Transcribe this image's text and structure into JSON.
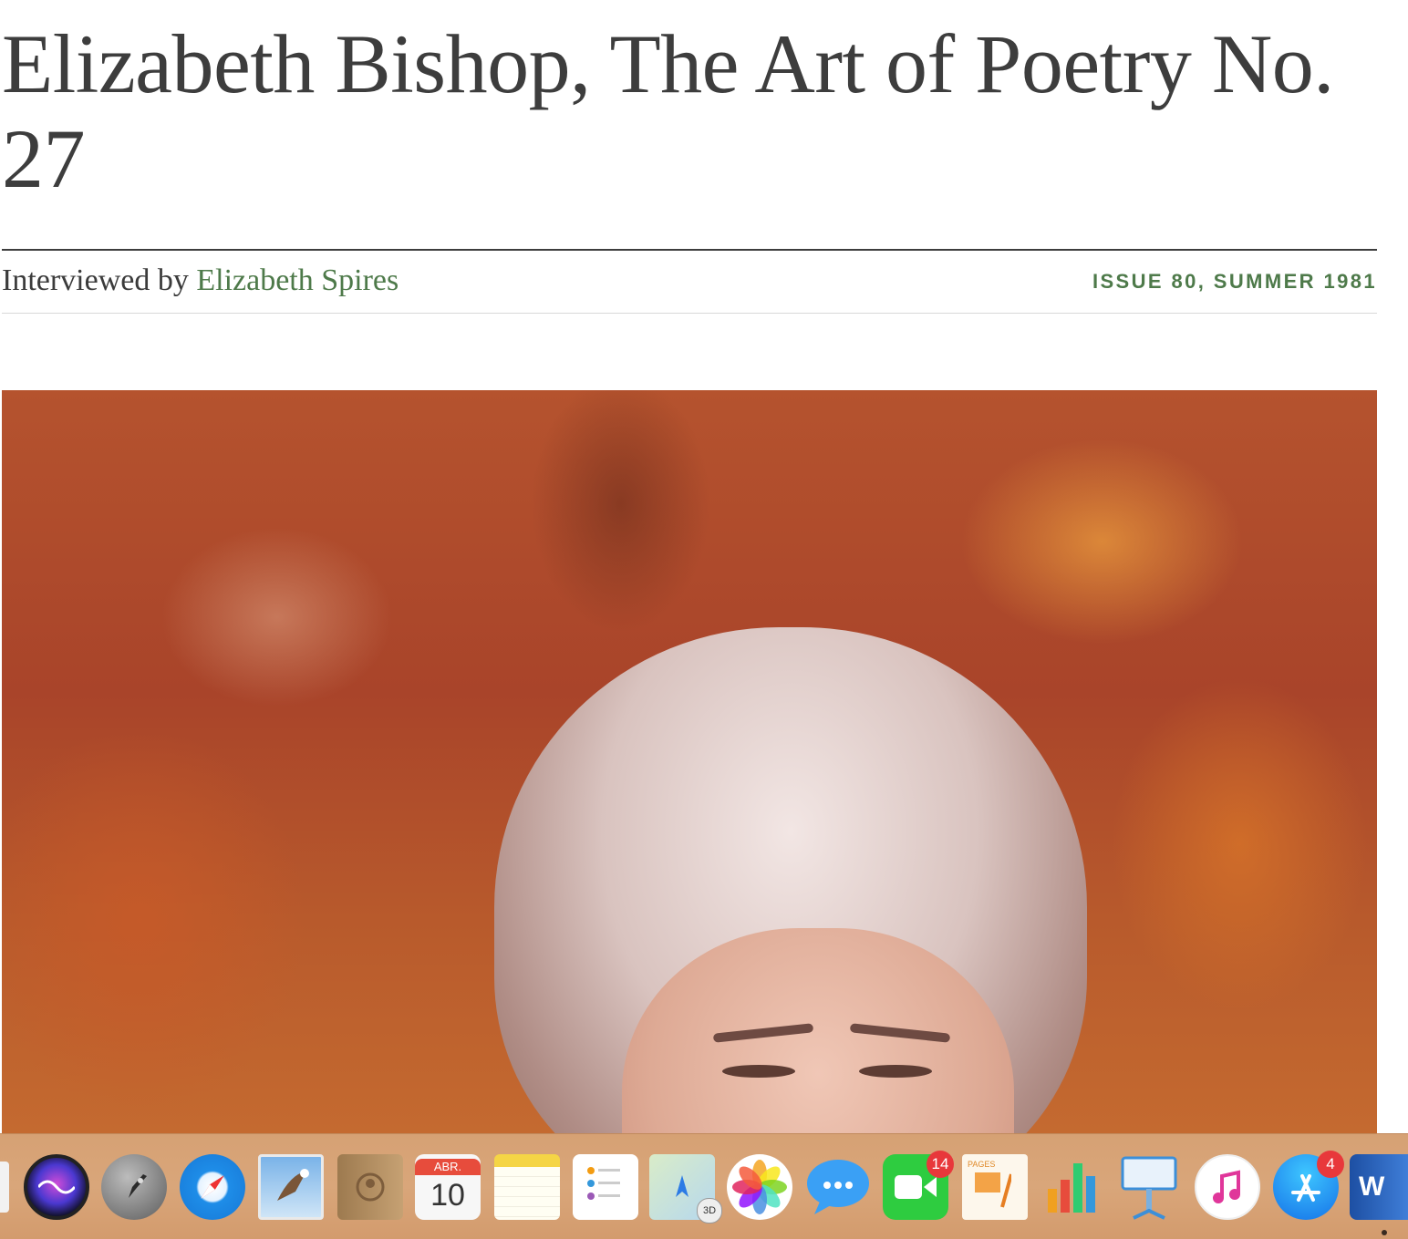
{
  "article": {
    "title": "Elizabeth Bishop, The Art of Poetry No. 27",
    "byline_prefix": "Interviewed by ",
    "author": "Elizabeth Spires",
    "issue": "ISSUE 80, SUMMER 1981"
  },
  "colors": {
    "accent_green": "#4e7a4a",
    "title_gray": "#3d3d3d"
  },
  "dock": {
    "calendar_month": "ABR.",
    "calendar_day": "10",
    "facetime_badge": "14",
    "appstore_badge": "4",
    "pages_label": "PAGES",
    "maps_label": "3D",
    "word_letter": "W",
    "items": [
      "siri-icon",
      "launchpad-icon",
      "safari-icon",
      "mail-icon",
      "contacts-icon",
      "calendar-icon",
      "notes-icon",
      "reminders-icon",
      "maps-icon",
      "photos-icon",
      "messages-icon",
      "facetime-icon",
      "pages-icon",
      "numbers-icon",
      "keynote-icon",
      "itunes-icon",
      "app-store-icon",
      "word-icon"
    ]
  }
}
